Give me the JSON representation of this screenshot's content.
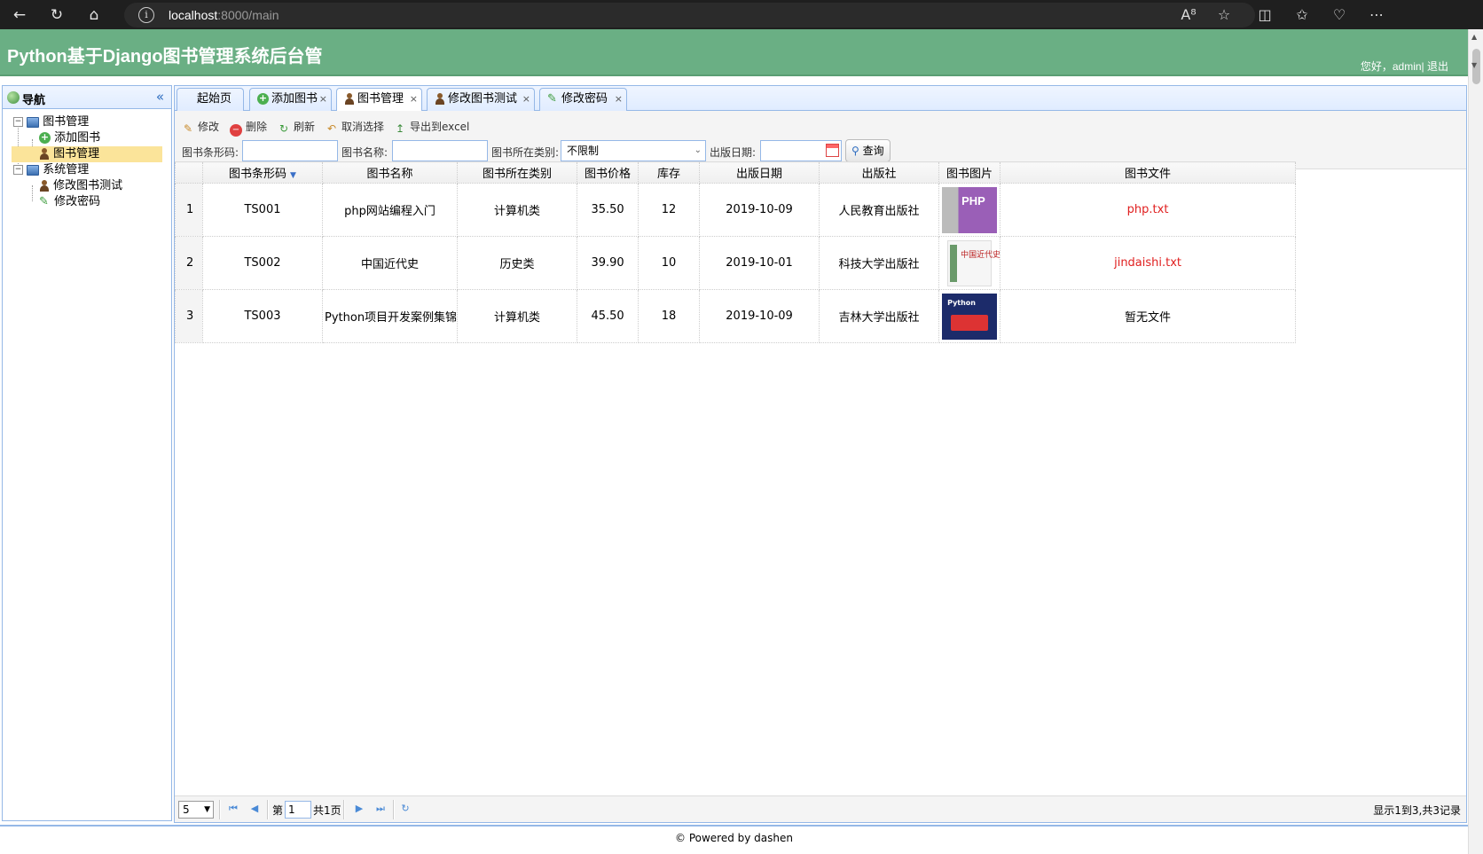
{
  "browser": {
    "url_host": "localhost",
    "url_path": ":8000/main"
  },
  "header": {
    "title": "Python基于Django图书管理系统后台管",
    "greeting": "您好，admin| 退出"
  },
  "nav": {
    "title": "导航",
    "collapse": "«",
    "tree": [
      {
        "label": "图书管理",
        "icon": "computer-icon"
      },
      {
        "label": "添加图书",
        "icon": "add-icon"
      },
      {
        "label": "图书管理",
        "icon": "user-icon"
      },
      {
        "label": "系统管理",
        "icon": "computer-icon"
      },
      {
        "label": "修改图书测试",
        "icon": "user-icon"
      },
      {
        "label": "修改密码",
        "icon": "pencil-icon"
      }
    ]
  },
  "tabs": [
    {
      "label": "起始页"
    },
    {
      "label": "添加图书"
    },
    {
      "label": "图书管理"
    },
    {
      "label": "修改图书测试"
    },
    {
      "label": "修改密码"
    }
  ],
  "toolbar": {
    "edit": "修改",
    "delete": "删除",
    "refresh": "刷新",
    "cancel_select": "取消选择",
    "export": "导出到excel"
  },
  "filters": {
    "barcode_label": "图书条形码:",
    "name_label": "图书名称:",
    "category_label": "图书所在类别:",
    "category_value": "不限制",
    "date_label": "出版日期:",
    "query_button": "查询"
  },
  "grid": {
    "columns": [
      "",
      "图书条形码",
      "图书名称",
      "图书所在类别",
      "图书价格",
      "库存",
      "出版日期",
      "出版社",
      "图书图片",
      "图书文件"
    ],
    "rows": [
      {
        "num": "1",
        "barcode": "TS001",
        "name": "php网站编程入门",
        "category": "计算机类",
        "price": "35.50",
        "stock": "12",
        "date": "2019-10-09",
        "publisher": "人民教育出版社",
        "cover": "php-book-cover",
        "cover_text": "PHP",
        "file": "php.txt"
      },
      {
        "num": "2",
        "barcode": "TS002",
        "name": "中国近代史",
        "category": "历史类",
        "price": "39.90",
        "stock": "10",
        "date": "2019-10-01",
        "publisher": "科技大学出版社",
        "cover": "history-book-cover",
        "cover_text": "中国近代史",
        "file": "jindaishi.txt"
      },
      {
        "num": "3",
        "barcode": "TS003",
        "name": "Python项目开发案例集锦",
        "category": "计算机类",
        "price": "45.50",
        "stock": "18",
        "date": "2019-10-09",
        "publisher": "吉林大学出版社",
        "cover": "python-book-cover",
        "cover_text": "Python",
        "file": "暂无文件"
      }
    ]
  },
  "pager": {
    "page_size": "5",
    "page_prefix": "第",
    "page_value": "1",
    "page_total": "共1页",
    "info": "显示1到3,共3记录"
  },
  "footer": {
    "text": "© Powered by dashen"
  }
}
